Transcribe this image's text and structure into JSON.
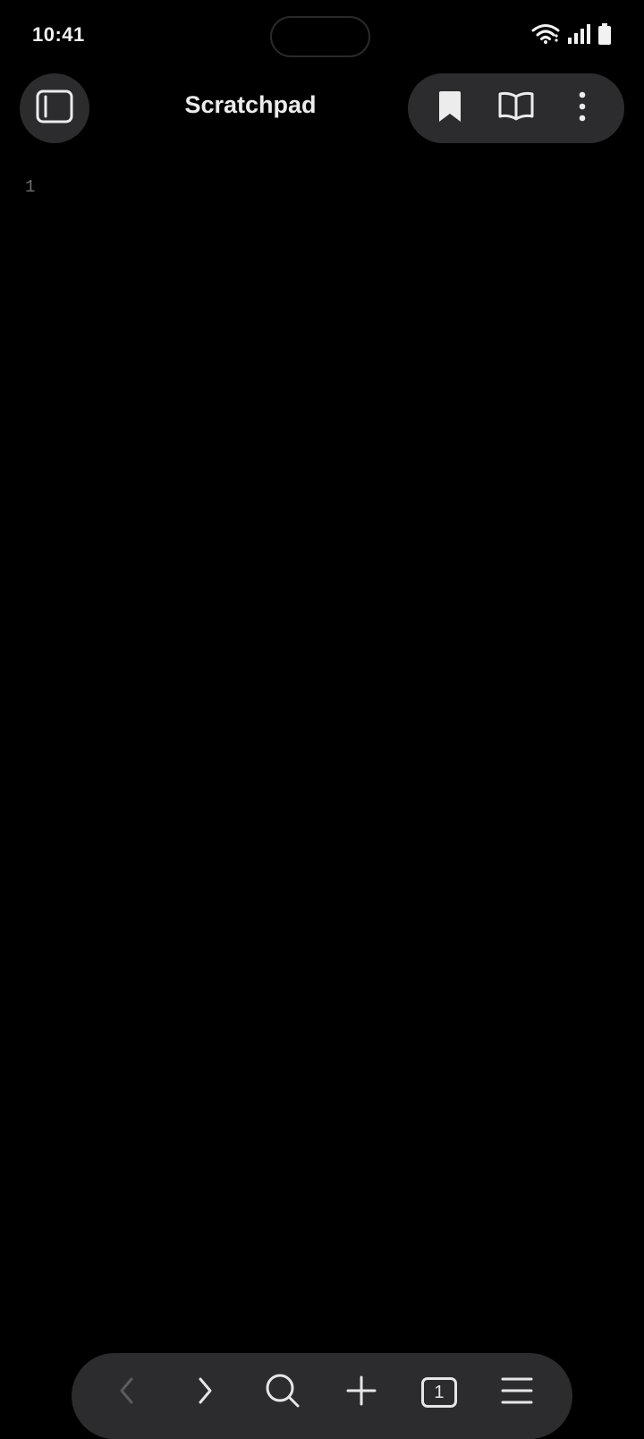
{
  "status_bar": {
    "time": "10:41",
    "icons": [
      "wifi-icon",
      "signal-icon",
      "battery-icon"
    ]
  },
  "header": {
    "title": "Scratchpad",
    "left_button_icon": "sidebar-toggle-icon",
    "actions": [
      "bookmark-icon",
      "reader-mode-icon",
      "more-options-icon"
    ]
  },
  "editor": {
    "line_numbers": [
      "1"
    ],
    "content": ""
  },
  "bottom_nav": {
    "items": [
      "back-icon",
      "forward-icon",
      "search-icon",
      "new-tab-icon",
      "tab-switcher",
      "menu-icon"
    ],
    "tab_count": "1",
    "back_enabled": false
  },
  "colors": {
    "background": "#000000",
    "surface": "#2c2c2e",
    "text": "#ececec",
    "muted": "#6f6f6f"
  }
}
